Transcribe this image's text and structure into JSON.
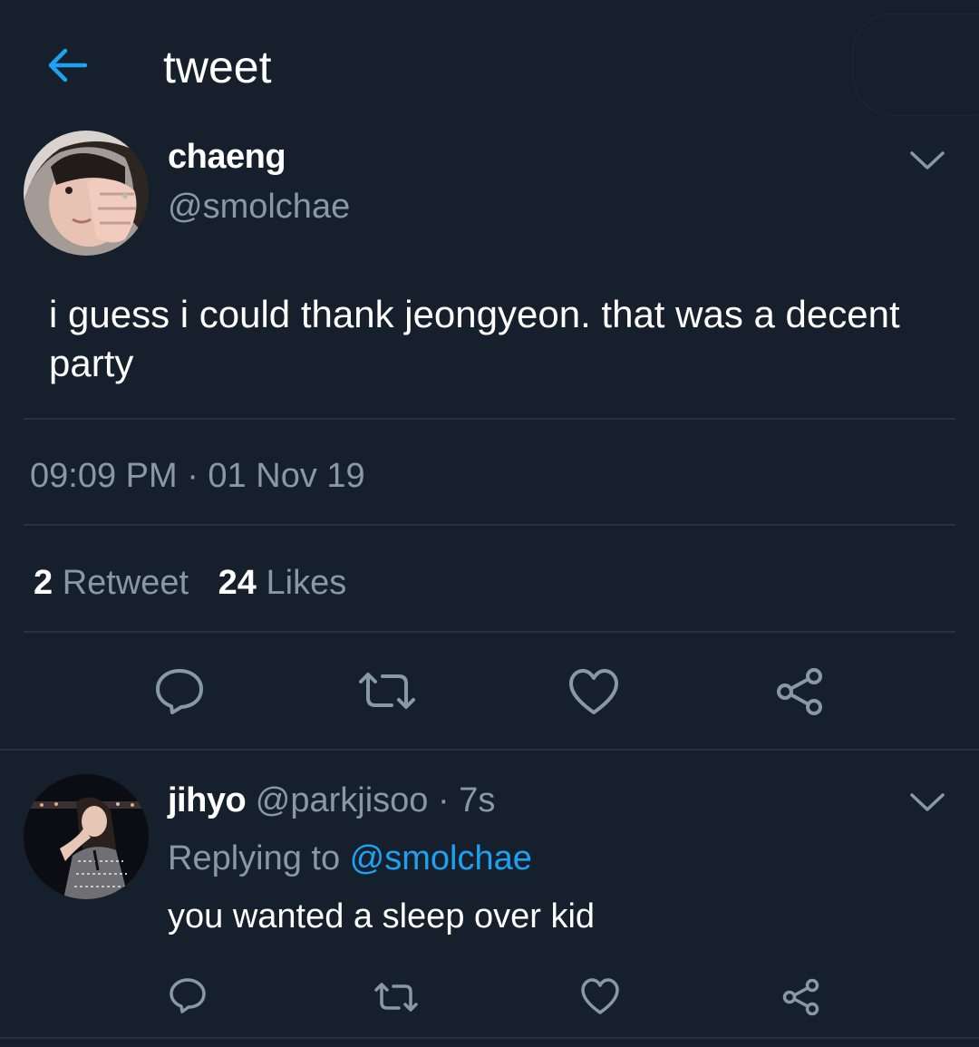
{
  "header": {
    "title": "tweet",
    "back_icon": "arrow-left-icon"
  },
  "tweet": {
    "author_name": "chaeng",
    "author_handle": "@smolchae",
    "text": "i guess i could thank jeongyeon. that was a decent party",
    "timestamp": "09:09 PM · 01 Nov 19",
    "retweet_count": "2",
    "retweet_label": "Retweet",
    "like_count": "24",
    "like_label": "Likes"
  },
  "reply": {
    "author_name": "jihyo",
    "author_handle": "@parkjisoo",
    "separator": " · ",
    "age": "7s",
    "replying_prefix": "Replying to ",
    "replying_mention": "@smolchae",
    "text": "you wanted a sleep over kid"
  },
  "colors": {
    "background": "#16202c",
    "accent": "#1da1f2",
    "secondary_text": "#8899a6",
    "divider": "#26323f",
    "icon": "#8899a6"
  }
}
